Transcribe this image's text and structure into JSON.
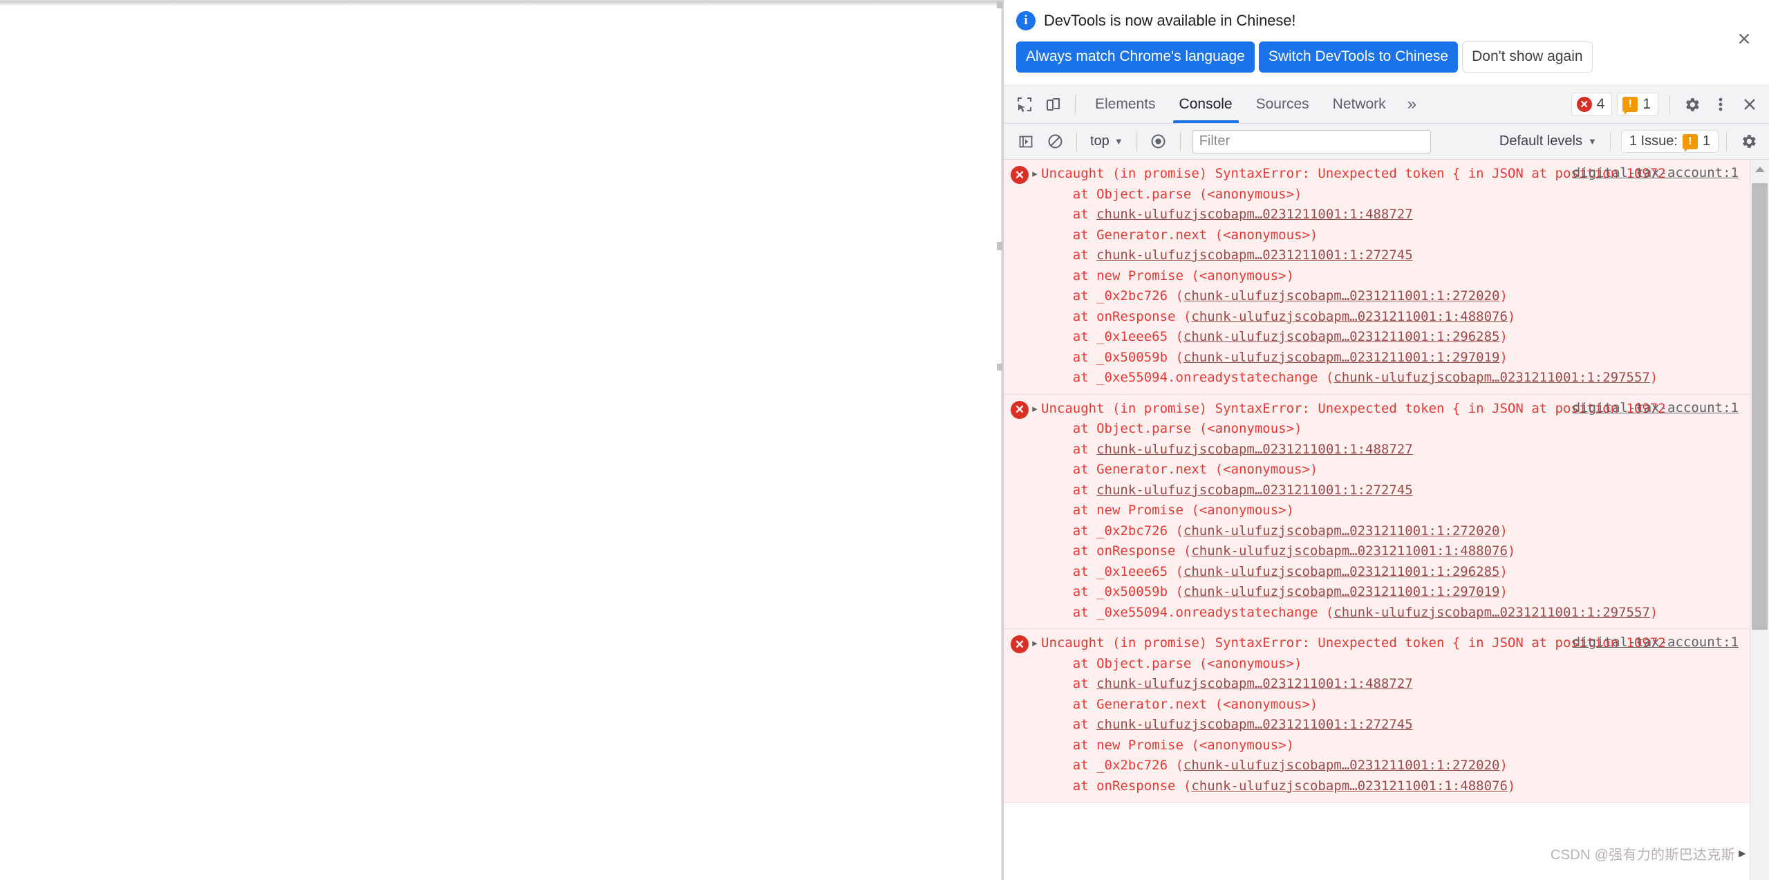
{
  "banner": {
    "icon": "info-icon",
    "message": "DevTools is now available in Chinese!",
    "primary_button": "Always match Chrome's language",
    "secondary_button": "Switch DevTools to Chinese",
    "tertiary_button": "Don't show again",
    "close_label": "✕",
    "accent_color": "#1a73e8"
  },
  "tabbar": {
    "inspect_icon": "inspect-element-icon",
    "device_icon": "device-toolbar-icon",
    "tabs": [
      {
        "label": "Elements",
        "active": false
      },
      {
        "label": "Console",
        "active": true
      },
      {
        "label": "Sources",
        "active": false
      },
      {
        "label": "Network",
        "active": false
      }
    ],
    "more_tabs": "»",
    "error_badge": {
      "count": "4",
      "color": "#d93025",
      "glyph": "✕"
    },
    "warning_badge": {
      "count": "1",
      "color": "#f29900",
      "glyph": "!"
    },
    "settings_icon": "gear-icon",
    "menu_icon": "kebab-menu-icon",
    "close_icon": "close-icon"
  },
  "filterbar": {
    "sidebar_toggle_icon": "console-sidebar-icon",
    "clear_icon": "clear-console-icon",
    "context": "top",
    "context_caret": "▼",
    "eye_icon": "live-expression-icon",
    "filter_placeholder": "Filter",
    "filter_value": "",
    "levels_label": "Default levels",
    "levels_caret": "▼",
    "issues_label": "1 Issue:",
    "issues_count": "1",
    "issues_glyph": "!",
    "settings_icon": "console-settings-gear-icon"
  },
  "console": {
    "messages": [
      {
        "icon": "error-icon",
        "disclosure": "▸",
        "source": "digital-tax-account:1",
        "lines": [
          {
            "segments": [
              {
                "t": "Uncaught (in promise) SyntaxError: Unexpected token { in JSON at position 10972",
                "link": false
              }
            ]
          },
          {
            "segments": [
              {
                "t": "    at Object.parse (<anonymous>)",
                "link": false
              }
            ]
          },
          {
            "segments": [
              {
                "t": "    at ",
                "link": false
              },
              {
                "t": "chunk-ulufuzjscobapm…0231211001:1:488727",
                "link": true
              }
            ]
          },
          {
            "segments": [
              {
                "t": "    at Generator.next (<anonymous>)",
                "link": false
              }
            ]
          },
          {
            "segments": [
              {
                "t": "    at ",
                "link": false
              },
              {
                "t": "chunk-ulufuzjscobapm…0231211001:1:272745",
                "link": true
              }
            ]
          },
          {
            "segments": [
              {
                "t": "    at new Promise (<anonymous>)",
                "link": false
              }
            ]
          },
          {
            "segments": [
              {
                "t": "    at _0x2bc726 (",
                "link": false
              },
              {
                "t": "chunk-ulufuzjscobapm…0231211001:1:272020",
                "link": true
              },
              {
                "t": ")",
                "link": false
              }
            ]
          },
          {
            "segments": [
              {
                "t": "    at onResponse (",
                "link": false
              },
              {
                "t": "chunk-ulufuzjscobapm…0231211001:1:488076",
                "link": true
              },
              {
                "t": ")",
                "link": false
              }
            ]
          },
          {
            "segments": [
              {
                "t": "    at _0x1eee65 (",
                "link": false
              },
              {
                "t": "chunk-ulufuzjscobapm…0231211001:1:296285",
                "link": true
              },
              {
                "t": ")",
                "link": false
              }
            ]
          },
          {
            "segments": [
              {
                "t": "    at _0x50059b (",
                "link": false
              },
              {
                "t": "chunk-ulufuzjscobapm…0231211001:1:297019",
                "link": true
              },
              {
                "t": ")",
                "link": false
              }
            ]
          },
          {
            "segments": [
              {
                "t": "    at _0xe55094.onreadystatechange (",
                "link": false
              },
              {
                "t": "chunk-ulufuzjscobapm…0231211001:1:297557",
                "link": true
              },
              {
                "t": ")",
                "link": false
              }
            ]
          }
        ]
      },
      {
        "icon": "error-icon",
        "disclosure": "▸",
        "source": "digital-tax-account:1",
        "lines": [
          {
            "segments": [
              {
                "t": "Uncaught (in promise) SyntaxError: Unexpected token { in JSON at position 10972",
                "link": false
              }
            ]
          },
          {
            "segments": [
              {
                "t": "    at Object.parse (<anonymous>)",
                "link": false
              }
            ]
          },
          {
            "segments": [
              {
                "t": "    at ",
                "link": false
              },
              {
                "t": "chunk-ulufuzjscobapm…0231211001:1:488727",
                "link": true
              }
            ]
          },
          {
            "segments": [
              {
                "t": "    at Generator.next (<anonymous>)",
                "link": false
              }
            ]
          },
          {
            "segments": [
              {
                "t": "    at ",
                "link": false
              },
              {
                "t": "chunk-ulufuzjscobapm…0231211001:1:272745",
                "link": true
              }
            ]
          },
          {
            "segments": [
              {
                "t": "    at new Promise (<anonymous>)",
                "link": false
              }
            ]
          },
          {
            "segments": [
              {
                "t": "    at _0x2bc726 (",
                "link": false
              },
              {
                "t": "chunk-ulufuzjscobapm…0231211001:1:272020",
                "link": true
              },
              {
                "t": ")",
                "link": false
              }
            ]
          },
          {
            "segments": [
              {
                "t": "    at onResponse (",
                "link": false
              },
              {
                "t": "chunk-ulufuzjscobapm…0231211001:1:488076",
                "link": true
              },
              {
                "t": ")",
                "link": false
              }
            ]
          },
          {
            "segments": [
              {
                "t": "    at _0x1eee65 (",
                "link": false
              },
              {
                "t": "chunk-ulufuzjscobapm…0231211001:1:296285",
                "link": true
              },
              {
                "t": ")",
                "link": false
              }
            ]
          },
          {
            "segments": [
              {
                "t": "    at _0x50059b (",
                "link": false
              },
              {
                "t": "chunk-ulufuzjscobapm…0231211001:1:297019",
                "link": true
              },
              {
                "t": ")",
                "link": false
              }
            ]
          },
          {
            "segments": [
              {
                "t": "    at _0xe55094.onreadystatechange (",
                "link": false
              },
              {
                "t": "chunk-ulufuzjscobapm…0231211001:1:297557",
                "link": true
              },
              {
                "t": ")",
                "link": false
              }
            ]
          }
        ]
      },
      {
        "icon": "error-icon",
        "disclosure": "▸",
        "source": "digital-tax-account:1",
        "lines": [
          {
            "segments": [
              {
                "t": "Uncaught (in promise) SyntaxError: Unexpected token { in JSON at position 10972",
                "link": false
              }
            ]
          },
          {
            "segments": [
              {
                "t": "    at Object.parse (<anonymous>)",
                "link": false
              }
            ]
          },
          {
            "segments": [
              {
                "t": "    at ",
                "link": false
              },
              {
                "t": "chunk-ulufuzjscobapm…0231211001:1:488727",
                "link": true
              }
            ]
          },
          {
            "segments": [
              {
                "t": "    at Generator.next (<anonymous>)",
                "link": false
              }
            ]
          },
          {
            "segments": [
              {
                "t": "    at ",
                "link": false
              },
              {
                "t": "chunk-ulufuzjscobapm…0231211001:1:272745",
                "link": true
              }
            ]
          },
          {
            "segments": [
              {
                "t": "    at new Promise (<anonymous>)",
                "link": false
              }
            ]
          },
          {
            "segments": [
              {
                "t": "    at _0x2bc726 (",
                "link": false
              },
              {
                "t": "chunk-ulufuzjscobapm…0231211001:1:272020",
                "link": true
              },
              {
                "t": ")",
                "link": false
              }
            ]
          },
          {
            "segments": [
              {
                "t": "    at onResponse (",
                "link": false
              },
              {
                "t": "chunk-ulufuzjscobapm…0231211001:1:488076",
                "link": true
              },
              {
                "t": ")",
                "link": false
              }
            ]
          }
        ]
      }
    ]
  },
  "scrollbar": {
    "up_arrow": "▲"
  },
  "watermark": {
    "text": "CSDN @强有力的斯巴达克斯",
    "cursor": "►"
  }
}
